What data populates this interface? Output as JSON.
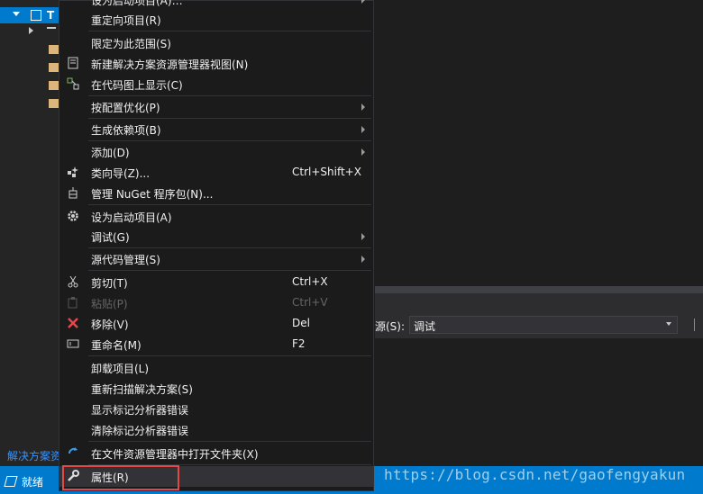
{
  "solution_explorer": {
    "selected_item_label": "T",
    "footer_label": "解决方案资"
  },
  "context_menu": {
    "items": [
      {
        "label": "设为启动项目(A)…",
        "icon": "",
        "shortcut": "",
        "submenu": true
      },
      {
        "label": "重定向项目(R)",
        "icon": "",
        "shortcut": "",
        "submenu": false
      },
      {
        "label": "限定为此范围(S)",
        "icon": "",
        "shortcut": "",
        "submenu": false
      },
      {
        "label": "新建解决方案资源管理器视图(N)",
        "icon": "new-view-icon",
        "shortcut": "",
        "submenu": false
      },
      {
        "label": "在代码图上显示(C)",
        "icon": "code-map-icon",
        "shortcut": "",
        "submenu": false
      },
      {
        "label": "按配置优化(P)",
        "icon": "",
        "shortcut": "",
        "submenu": true
      },
      {
        "label": "生成依赖项(B)",
        "icon": "",
        "shortcut": "",
        "submenu": true
      },
      {
        "label": "添加(D)",
        "icon": "",
        "shortcut": "",
        "submenu": true
      },
      {
        "label": "类向导(Z)...",
        "icon": "class-wizard-icon",
        "shortcut": "Ctrl+Shift+X",
        "submenu": false
      },
      {
        "label": "管理 NuGet 程序包(N)...",
        "icon": "nuget-icon",
        "shortcut": "",
        "submenu": false
      },
      {
        "label": "设为启动项目(A)",
        "icon": "gear-icon",
        "shortcut": "",
        "submenu": false
      },
      {
        "label": "调试(G)",
        "icon": "",
        "shortcut": "",
        "submenu": true
      },
      {
        "label": "源代码管理(S)",
        "icon": "",
        "shortcut": "",
        "submenu": true
      },
      {
        "label": "剪切(T)",
        "icon": "scissors-icon",
        "shortcut": "Ctrl+X",
        "submenu": false
      },
      {
        "label": "粘贴(P)",
        "icon": "paste-icon",
        "shortcut": "Ctrl+V",
        "submenu": false,
        "disabled": true
      },
      {
        "label": "移除(V)",
        "icon": "remove-icon",
        "shortcut": "Del",
        "submenu": false
      },
      {
        "label": "重命名(M)",
        "icon": "rename-icon",
        "shortcut": "F2",
        "submenu": false
      },
      {
        "label": "卸载项目(L)",
        "icon": "",
        "shortcut": "",
        "submenu": false
      },
      {
        "label": "重新扫描解决方案(S)",
        "icon": "",
        "shortcut": "",
        "submenu": false
      },
      {
        "label": "显示标记分析器错误",
        "icon": "",
        "shortcut": "",
        "submenu": false
      },
      {
        "label": "清除标记分析器错误",
        "icon": "",
        "shortcut": "",
        "submenu": false
      },
      {
        "label": "在文件资源管理器中打开文件夹(X)",
        "icon": "open-folder-icon",
        "shortcut": "",
        "submenu": false
      },
      {
        "label": "属性(R)",
        "icon": "wrench-icon",
        "shortcut": "",
        "submenu": false
      }
    ]
  },
  "output_panel": {
    "source_label": "源(S):",
    "source_value": "调试"
  },
  "status_bar": {
    "text": "就绪",
    "watermark": "https://blog.csdn.net/gaofengyakun"
  },
  "colors": {
    "accent": "#007acc",
    "highlight_border": "#e34848"
  }
}
